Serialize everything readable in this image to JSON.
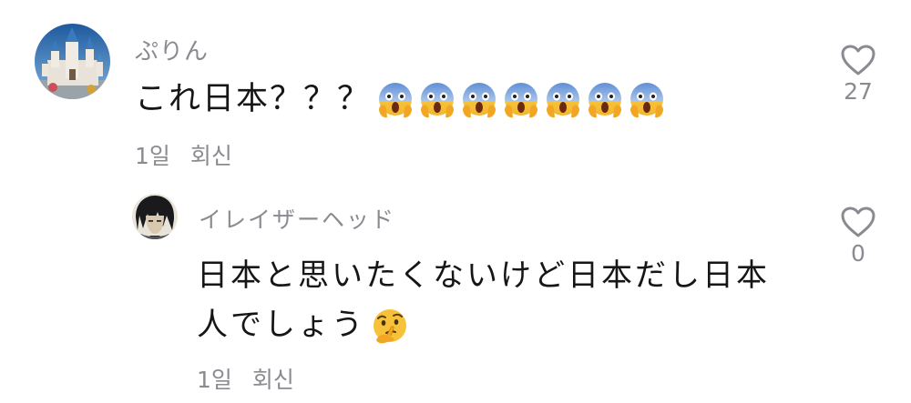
{
  "comments": [
    {
      "username": "ぷりん",
      "text": "これ日本？？？",
      "emoji_icon": "face-screaming-in-fear-icon",
      "emoji_count": 7,
      "time": "1일",
      "reply_label": "회신",
      "likes": "27"
    },
    {
      "username": "イレイザーヘッド",
      "text": "日本と思いたくないけど日本だし日本人でしょう",
      "emoji_icon": "thinking-face-icon",
      "time": "1일",
      "reply_label": "회신",
      "likes": "0"
    }
  ],
  "colors": {
    "text": "#161616",
    "muted": "#8a8b91",
    "heart": "#8a8b91",
    "background": "#ffffff"
  }
}
